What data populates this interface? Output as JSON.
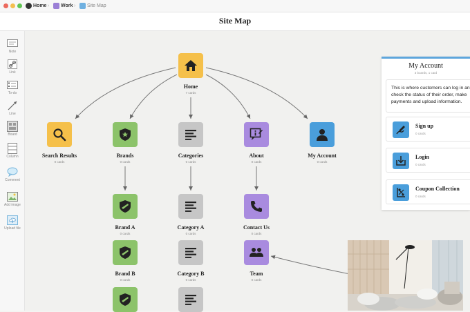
{
  "breadcrumb": [
    {
      "label": "Home"
    },
    {
      "label": "Work"
    },
    {
      "label": "Site Map"
    }
  ],
  "header": {
    "title": "Site Map"
  },
  "toolbar": {
    "items": [
      {
        "label": "Note",
        "icon": "note-icon"
      },
      {
        "label": "Link",
        "icon": "link-icon"
      },
      {
        "label": "To-do",
        "icon": "todo-icon"
      },
      {
        "label": "Line",
        "icon": "line-icon"
      },
      {
        "label": "Board",
        "icon": "board-icon"
      },
      {
        "label": "Column",
        "icon": "column-icon"
      },
      {
        "label": "Comment",
        "icon": "comment-icon"
      },
      {
        "label": "Add image",
        "icon": "image-icon"
      },
      {
        "label": "Upload file",
        "icon": "upload-icon"
      }
    ]
  },
  "nodes": {
    "home": {
      "title": "Home",
      "sub": "7 cards",
      "color": "#f5c04a",
      "icon": "home-icon"
    },
    "search": {
      "title": "Search Results",
      "sub": "0 cards",
      "color": "#f5c04a",
      "icon": "search-icon"
    },
    "brands": {
      "title": "Brands",
      "sub": "0 cards",
      "color": "#8cc36a",
      "icon": "badge-icon"
    },
    "categories": {
      "title": "Categories",
      "sub": "0 cards",
      "color": "#c6c6c6",
      "icon": "list-icon"
    },
    "about": {
      "title": "About",
      "sub": "0 cards",
      "color": "#a98bdf",
      "icon": "info-icon"
    },
    "account": {
      "title": "My Account",
      "sub": "0 cards",
      "color": "#4a9edb",
      "icon": "person-icon"
    },
    "brand_a": {
      "title": "Brand A",
      "sub": "0 cards",
      "color": "#8cc36a",
      "icon": "shield-icon"
    },
    "category_a": {
      "title": "Category A",
      "sub": "0 cards",
      "color": "#c6c6c6",
      "icon": "list-icon"
    },
    "contact": {
      "title": "Contact Us",
      "sub": "0 cards",
      "color": "#a98bdf",
      "icon": "phone-icon"
    },
    "brand_b": {
      "title": "Brand B",
      "sub": "0 cards",
      "color": "#8cc36a",
      "icon": "shield-icon"
    },
    "category_b": {
      "title": "Category B",
      "sub": "0 cards",
      "color": "#c6c6c6",
      "icon": "list-icon"
    },
    "team": {
      "title": "Team",
      "sub": "0 cards",
      "color": "#a98bdf",
      "icon": "people-icon"
    }
  },
  "panel": {
    "title": "My Account",
    "sub": "3 boards, 1 card",
    "description_lines": [
      "This is where customers can log in an",
      "check the status of their order, make",
      "payments and upload information."
    ],
    "cards": [
      {
        "title": "Sign up",
        "sub": "0 cards",
        "icon": "signup-icon"
      },
      {
        "title": "Login",
        "sub": "0 cards",
        "icon": "login-icon"
      },
      {
        "title": "Coupon Collection",
        "sub": "0 cards",
        "icon": "coupon-icon"
      }
    ]
  },
  "colors": {
    "yellow": "#f5c04a",
    "green": "#8cc36a",
    "grey": "#c6c6c6",
    "purple": "#a98bdf",
    "blue": "#4a9edb"
  }
}
